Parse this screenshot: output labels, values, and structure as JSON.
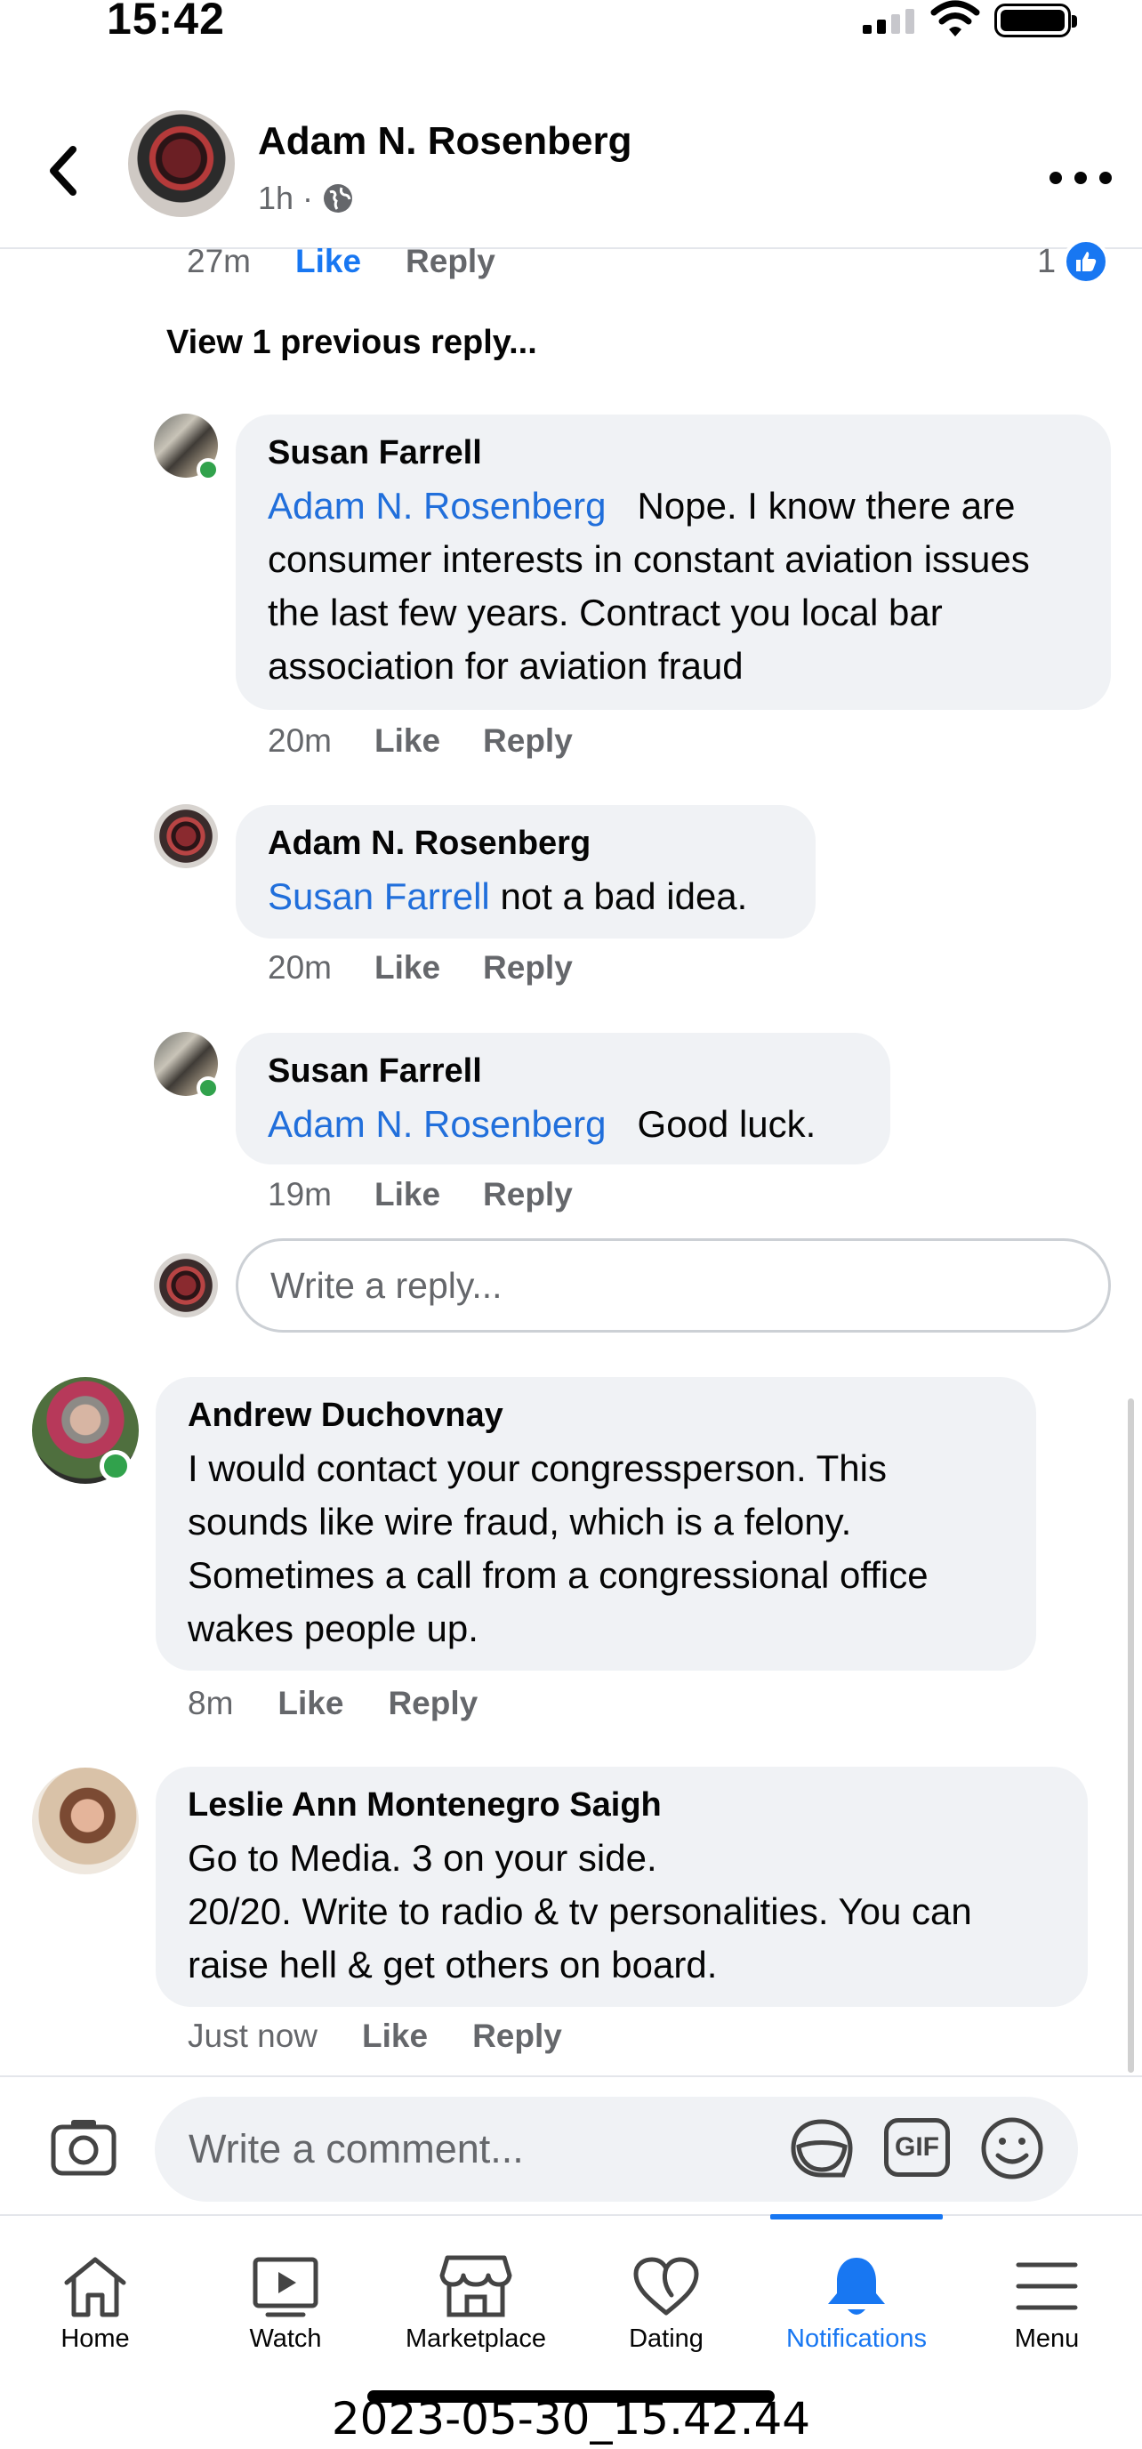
{
  "status_bar": {
    "time": "15:42"
  },
  "header": {
    "name": "Adam N. Rosenberg",
    "time": "1h",
    "separator": "·"
  },
  "top_comment": {
    "time": "27m",
    "like": "Like",
    "reply": "Reply",
    "like_count": "1"
  },
  "view_previous": "View 1 previous reply...",
  "replies": [
    {
      "author": "Susan Farrell",
      "mention": "Adam N. Rosenberg",
      "text": "Nope.  I know there are consumer interests in constant aviation issues the last few years.  Contract you local bar association for aviation fraud",
      "time": "20m",
      "like": "Like",
      "reply": "Reply"
    },
    {
      "author": "Adam N. Rosenberg",
      "mention": "Susan Farrell",
      "text": "not a bad idea.",
      "time": "20m",
      "like": "Like",
      "reply": "Reply"
    },
    {
      "author": "Susan Farrell",
      "mention": "Adam N. Rosenberg",
      "text": "Good luck.",
      "time": "19m",
      "like": "Like",
      "reply": "Reply"
    }
  ],
  "reply_input": {
    "placeholder": "Write a reply..."
  },
  "comments": [
    {
      "author": "Andrew Duchovnay",
      "text": "I would contact your congressperson. This sounds like wire fraud, which is a felony. Sometimes a call from a congressional office wakes people up.",
      "time": "8m",
      "like": "Like",
      "reply": "Reply"
    },
    {
      "author": "Leslie Ann Montenegro Saigh",
      "text_lines": [
        "Go to Media. 3 on your side.",
        "20/20. Write to radio & tv personalities. You can raise hell & get others on board."
      ],
      "time": "Just now",
      "like": "Like",
      "reply": "Reply"
    }
  ],
  "composer": {
    "placeholder": "Write a comment...",
    "gif_label": "GIF"
  },
  "tabs": [
    {
      "label": "Home",
      "icon": "home-icon"
    },
    {
      "label": "Watch",
      "icon": "watch-icon"
    },
    {
      "label": "Marketplace",
      "icon": "marketplace-icon"
    },
    {
      "label": "Dating",
      "icon": "heart-icon"
    },
    {
      "label": "Notifications",
      "icon": "bell-icon",
      "active": true
    },
    {
      "label": "Menu",
      "icon": "menu-icon"
    }
  ],
  "caption": "2023-05-30_15.42.44",
  "colors": {
    "accent": "#1877f2",
    "mention": "#216fdb",
    "bubble": "#f0f2f5",
    "online": "#31a24c"
  }
}
